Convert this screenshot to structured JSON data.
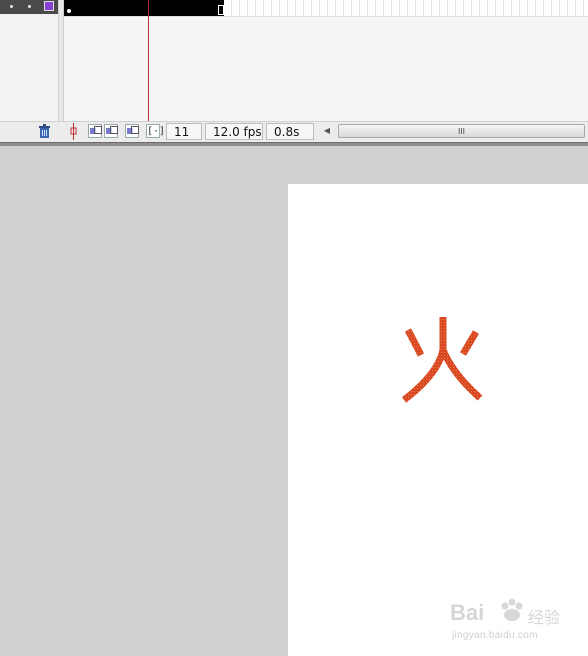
{
  "timeline": {
    "layer": {
      "color": "#8a3fd0"
    },
    "current_frame": "11",
    "frame_rate": "12.0 fps",
    "elapsed_time": "0.8s",
    "scroll_grip": "III"
  },
  "stage": {
    "character": "火",
    "character_color": "#d94a22"
  },
  "watermark": {
    "brand": "Bai",
    "brand_suffix": "经验",
    "url": "jingyan.baidu.com"
  }
}
